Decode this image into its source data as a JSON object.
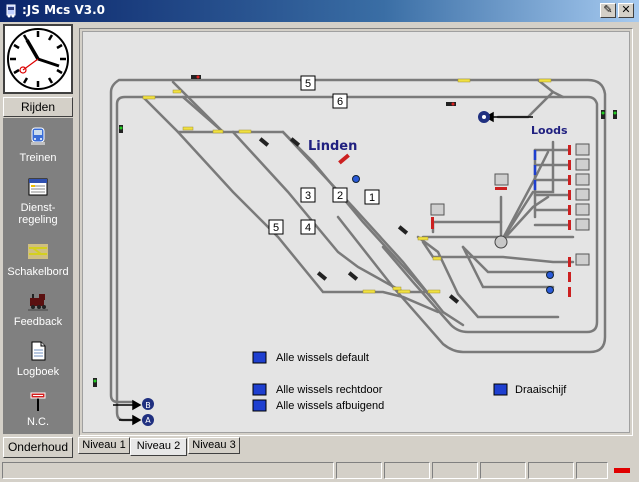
{
  "window": {
    "title": ":JS Mcs V3.0"
  },
  "sidebar": {
    "rijden_label": "Rijden",
    "items": [
      {
        "label": "Treinen",
        "icon": "train-icon"
      },
      {
        "label": "Dienst-\nregeling",
        "icon": "timetable-icon"
      },
      {
        "label": "Schakelbord",
        "icon": "switchboard-icon"
      },
      {
        "label": "Feedback",
        "icon": "locomotive-icon"
      },
      {
        "label": "Logboek",
        "icon": "logbook-icon"
      },
      {
        "label": "N.C.",
        "icon": "signal-icon"
      }
    ],
    "onderhoud_label": "Onderhoud"
  },
  "track": {
    "station_label": "Linden",
    "depot_label": "Loods",
    "track_numbers": [
      "5",
      "6",
      "3",
      "2",
      "1",
      "5",
      "4"
    ],
    "endpoint_markers": [
      "B",
      "A"
    ]
  },
  "buttons": {
    "default": "Alle wissels default",
    "rechtdoor": "Alle wissels rechtdoor",
    "afbuigend": "Alle wissels afbuigend",
    "draaischijf": "Draaischijf"
  },
  "tabs": [
    "Niveau 1",
    "Niveau 2",
    "Niveau 3"
  ],
  "active_tab": "Niveau 2",
  "colors": {
    "track": "#7a7a7a",
    "accent_blue": "#1e3fd0",
    "label_navy": "#202080",
    "signal_red": "#cc2020"
  }
}
